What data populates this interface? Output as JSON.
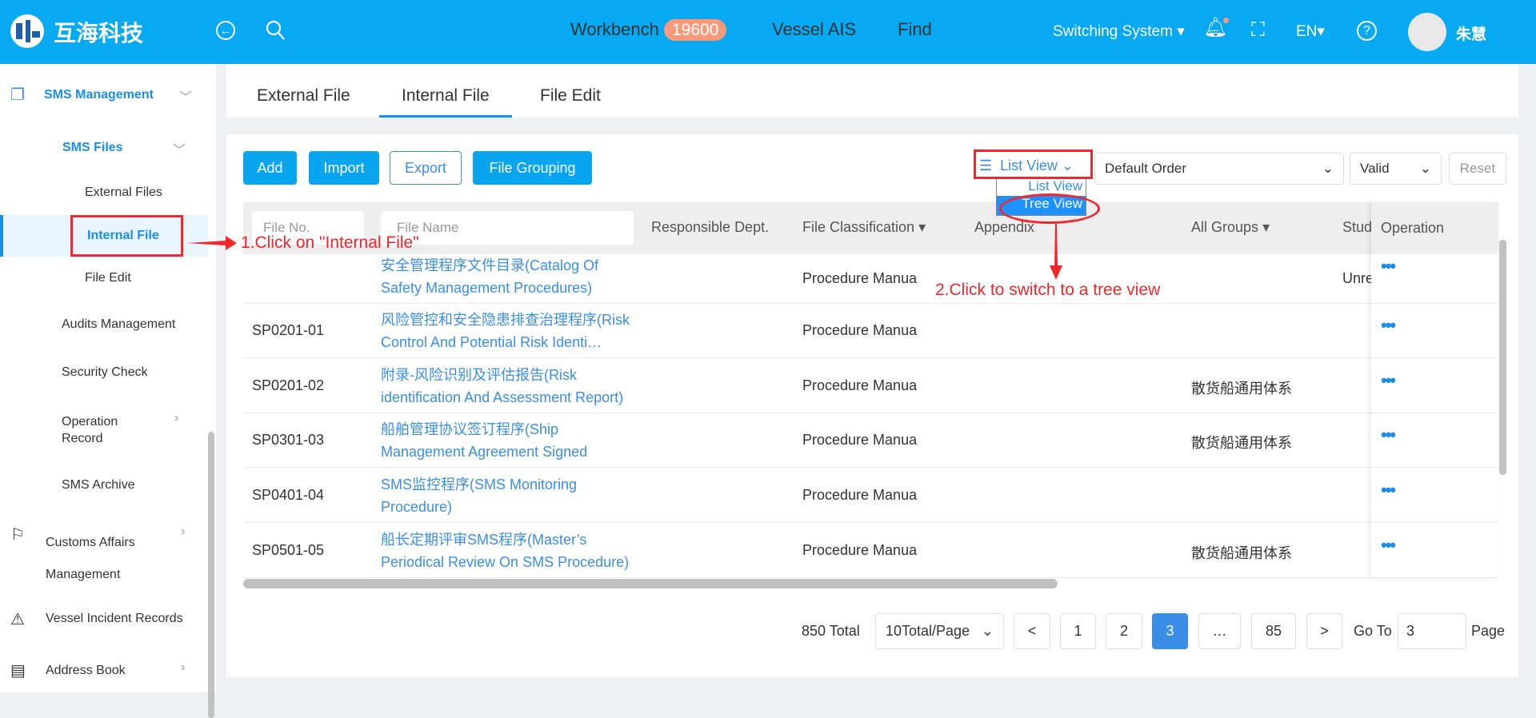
{
  "header": {
    "brand": "互海科技",
    "nav": [
      {
        "label": "Workbench",
        "badge": "19600"
      },
      {
        "label": "Vessel AIS"
      },
      {
        "label": "Find"
      }
    ],
    "switching": "Switching System",
    "lang": "EN",
    "user": "朱慧",
    "accent": "#06a9f2"
  },
  "sidebar": {
    "items": [
      "SMS Management",
      "SMS Files",
      "External Files",
      "Internal File",
      "File Edit",
      "Audits Management",
      "Security Check",
      "Operation Record",
      "SMS Archive",
      "Customs Affairs Management",
      "Vessel Incident Records",
      "Address Book"
    ]
  },
  "tabs": [
    "External File",
    "Internal File",
    "File Edit"
  ],
  "toolbar": {
    "add": "Add",
    "import": "Import",
    "export": "Export",
    "grouping": "File Grouping",
    "view": "List View",
    "view_options": [
      "List View",
      "Tree View"
    ],
    "order": "Default Order",
    "status": "Valid",
    "reset": "Reset"
  },
  "table": {
    "filters": {
      "file_no": "File No.",
      "file_name": "File Name"
    },
    "headers": [
      "Responsible Dept.",
      "File Classification",
      "Appendix",
      "All Groups",
      "Stud",
      "Operation"
    ],
    "rows": [
      {
        "no": "",
        "name": "安全管理程序文件目录(Catalog Of Safety Management Procedures)",
        "cls": "Procedure Manua",
        "group": "",
        "stud": "Unre"
      },
      {
        "no": "SP0201-01",
        "name": "风险管控和安全隐患排查治理程序(Risk Control And Potential Risk Identi…",
        "cls": "Procedure Manua",
        "group": "",
        "stud": ""
      },
      {
        "no": "SP0201-02",
        "name": "附录-风险识别及评估报告(Risk identification And Assessment Report)",
        "cls": "Procedure Manua",
        "group": "散货船通用体系",
        "stud": ""
      },
      {
        "no": "SP0301-03",
        "name": "船舶管理协议签订程序(Ship Management Agreement Signed Procedure)",
        "cls": "Procedure Manua",
        "group": "散货船通用体系",
        "stud": ""
      },
      {
        "no": "SP0401-04",
        "name": "SMS监控程序(SMS Monitoring Procedure)",
        "cls": "Procedure Manua",
        "group": "",
        "stud": ""
      },
      {
        "no": "SP0501-05",
        "name": "船长定期评审SMS程序(Master’s Periodical Review On SMS Procedure)",
        "cls": "Procedure Manua",
        "group": "散货船通用体系",
        "stud": ""
      }
    ]
  },
  "pagination": {
    "total": "850 Total",
    "per_page": "10Total/Page",
    "pages": [
      "<",
      "1",
      "2",
      "3",
      "…",
      "85",
      ">"
    ],
    "current": "3",
    "goto_label": "Go To",
    "goto_value": "3",
    "page_label": "Page"
  },
  "annotations": {
    "step1": "1.Click on \"Internal File\"",
    "step2": "2.Click to switch to a tree view"
  }
}
